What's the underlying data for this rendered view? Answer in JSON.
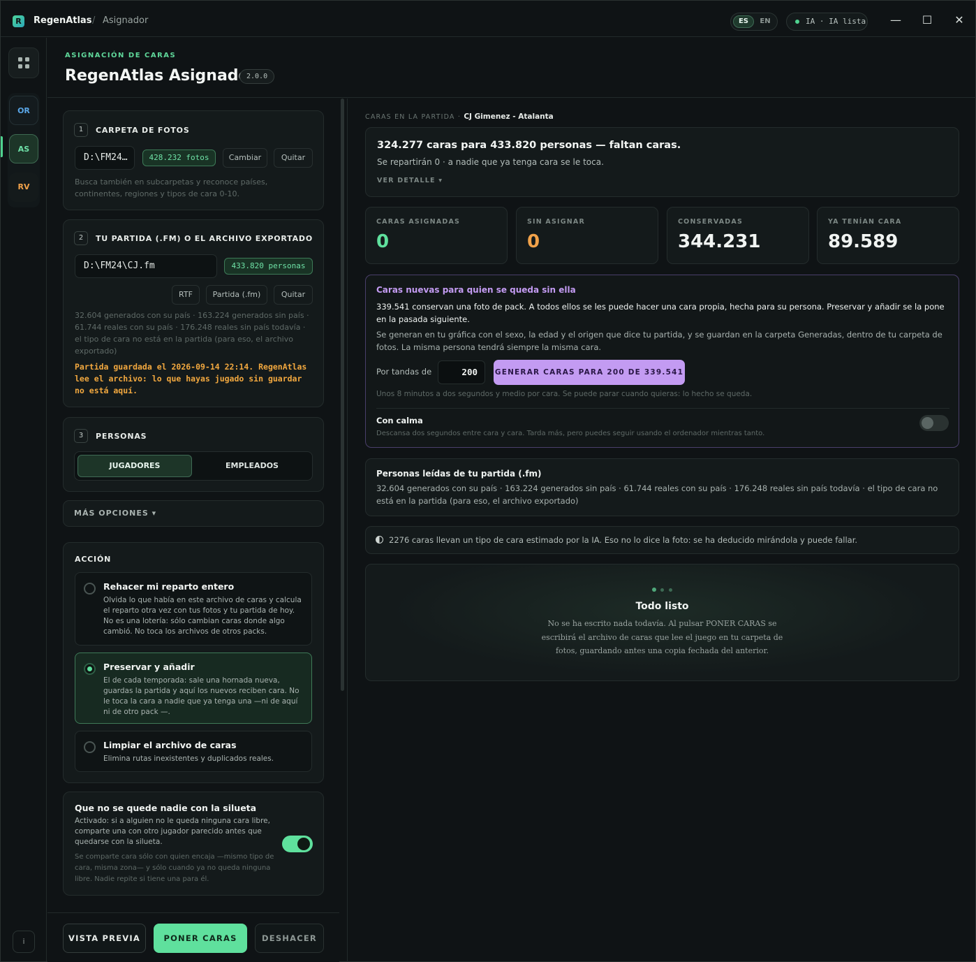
{
  "titlebar": {
    "logo_letter": "R",
    "app_name": "RegenAtlas",
    "separator": "/",
    "section": "Asignador",
    "lang_es": "ES",
    "lang_en": "EN",
    "ia_status": "IA · IA lista",
    "minimize": "—",
    "maximize": "☐",
    "close": "✕"
  },
  "rail": {
    "items": [
      {
        "label": "OR",
        "color": "#5aa7e8"
      },
      {
        "label": "AS",
        "color": "#6fe0a8"
      },
      {
        "label": "RV",
        "color": "#f1a24a"
      }
    ],
    "info": "i"
  },
  "header": {
    "eyebrow": "ASIGNACIÓN DE CARAS",
    "title": "RegenAtlas Asignador",
    "version": "2.0.0"
  },
  "step1": {
    "num": "1",
    "label": "CARPETA DE FOTOS",
    "path": "D:\\FM24…",
    "count": "428.232 fotos",
    "change": "Cambiar",
    "remove": "Quitar",
    "help": "Busca también en subcarpetas y reconoce países, continentes, regiones y tipos de cara 0-10."
  },
  "step2": {
    "num": "2",
    "label": "TU PARTIDA (.FM) O EL ARCHIVO EXPORTADO",
    "path": "D:\\FM24\\CJ.fm",
    "count": "433.820 personas",
    "rtf": "RTF",
    "partida": "Partida (.fm)",
    "remove": "Quitar",
    "help": "32.604 generados con su país · 163.224 generados sin país · 61.744 reales con su país · 176.248 reales sin país todavía · el tipo de cara no está en la partida (para eso, el archivo exportado)",
    "warning": "Partida guardada el 2026-09-14 22:14. RegenAtlas lee el archivo: lo que hayas jugado sin guardar no está aquí."
  },
  "step3": {
    "num": "3",
    "label": "PERSONAS",
    "tab_players": "JUGADORES",
    "tab_staff": "EMPLEADOS"
  },
  "more_options": "MÁS OPCIONES ▾",
  "action": {
    "label": "ACCIÓN",
    "options": [
      {
        "title": "Rehacer mi reparto entero",
        "desc": "Olvida lo que había en este archivo de caras y calcula el reparto otra vez con tus fotos y tu partida de hoy. No es una lotería: sólo cambian caras donde algo cambió. No toca los archivos de otros packs."
      },
      {
        "title": "Preservar y añadir",
        "desc": "El de cada temporada: sale una hornada nueva, guardas la partida y aquí los nuevos reciben cara. No le toca la cara a nadie que ya tenga una —ni de aquí ni de otro pack —."
      },
      {
        "title": "Limpiar el archivo de caras",
        "desc": "Elimina rutas inexistentes y duplicados reales."
      }
    ],
    "selected": 1
  },
  "silhouette": {
    "title": "Que no se quede nadie con la silueta",
    "desc": "Activado: si a alguien no le queda ninguna cara libre, comparte una con otro jugador parecido antes que quedarse con la silueta.",
    "note": "Se comparte cara sólo con quien encaja —mismo tipo de cara, misma zona— y sólo cuando ya no queda ninguna libre. Nadie repite si tiene una para él.",
    "enabled": true
  },
  "footer": {
    "preview": "VISTA PREVIA",
    "apply": "PONER CARAS",
    "undo": "DESHACER"
  },
  "right": {
    "section_label": "CARAS EN LA PARTIDA ·",
    "save_name": "CJ Gimenez - Atalanta",
    "summary_title": "324.277 caras para 433.820 personas — faltan caras.",
    "summary_sub": "Se repartirán 0 · a nadie que ya tenga cara se le toca.",
    "detail_link": "VER DETALLE ▾",
    "stats": [
      {
        "label": "CARAS ASIGNADAS",
        "value": "0",
        "color": "#5fe09d"
      },
      {
        "label": "SIN ASIGNAR",
        "value": "0",
        "color": "#f1a24a"
      },
      {
        "label": "CONSERVADAS",
        "value": "344.231",
        "color": "#f1f4f2"
      },
      {
        "label": "YA TENÍAN CARA",
        "value": "89.589",
        "color": "#f1f4f2"
      }
    ],
    "gen": {
      "title": "Caras nuevas para quien se queda sin ella",
      "lead": "339.541 conservan una foto de pack. A todos ellos se les puede hacer una cara propia, hecha para su persona. Preservar y añadir se la pone en la pasada siguiente.",
      "desc": "Se generan en tu gráfica con el sexo, la edad y el origen que dice tu partida, y se guardan en la carpeta Generadas, dentro de tu carpeta de fotos. La misma persona tendrá siempre la misma cara.",
      "batch_label": "Por tandas de",
      "batch_value": "200",
      "button": "GENERAR CARAS PARA 200 DE 339.541",
      "eta": "Unos 8 minutos a dos segundos y medio por cara. Se puede parar cuando quieras: lo hecho se queda.",
      "calm_title": "Con calma",
      "calm_desc": "Descansa dos segundos entre cara y cara. Tarda más, pero puedes seguir usando el ordenador mientras tanto.",
      "calm_enabled": false
    },
    "people": {
      "title": "Personas leídas de tu partida (.fm)",
      "desc": "32.604 generados con su país · 163.224 generados sin país · 61.744 reales con su país · 176.248 reales sin país todavía · el tipo de cara no está en la partida (para eso, el archivo exportado)"
    },
    "ai_note": "2276 caras llevan un tipo de cara estimado por la IA. Eso no lo dice la foto: se ha deducido mirándola y puede fallar.",
    "ready": {
      "title": "Todo listo",
      "desc": "No se ha escrito nada todavía. Al pulsar PONER CARAS se escribirá el archivo de caras que lee el juego en tu carpeta de fotos, guardando antes una copia fechada del anterior."
    }
  }
}
